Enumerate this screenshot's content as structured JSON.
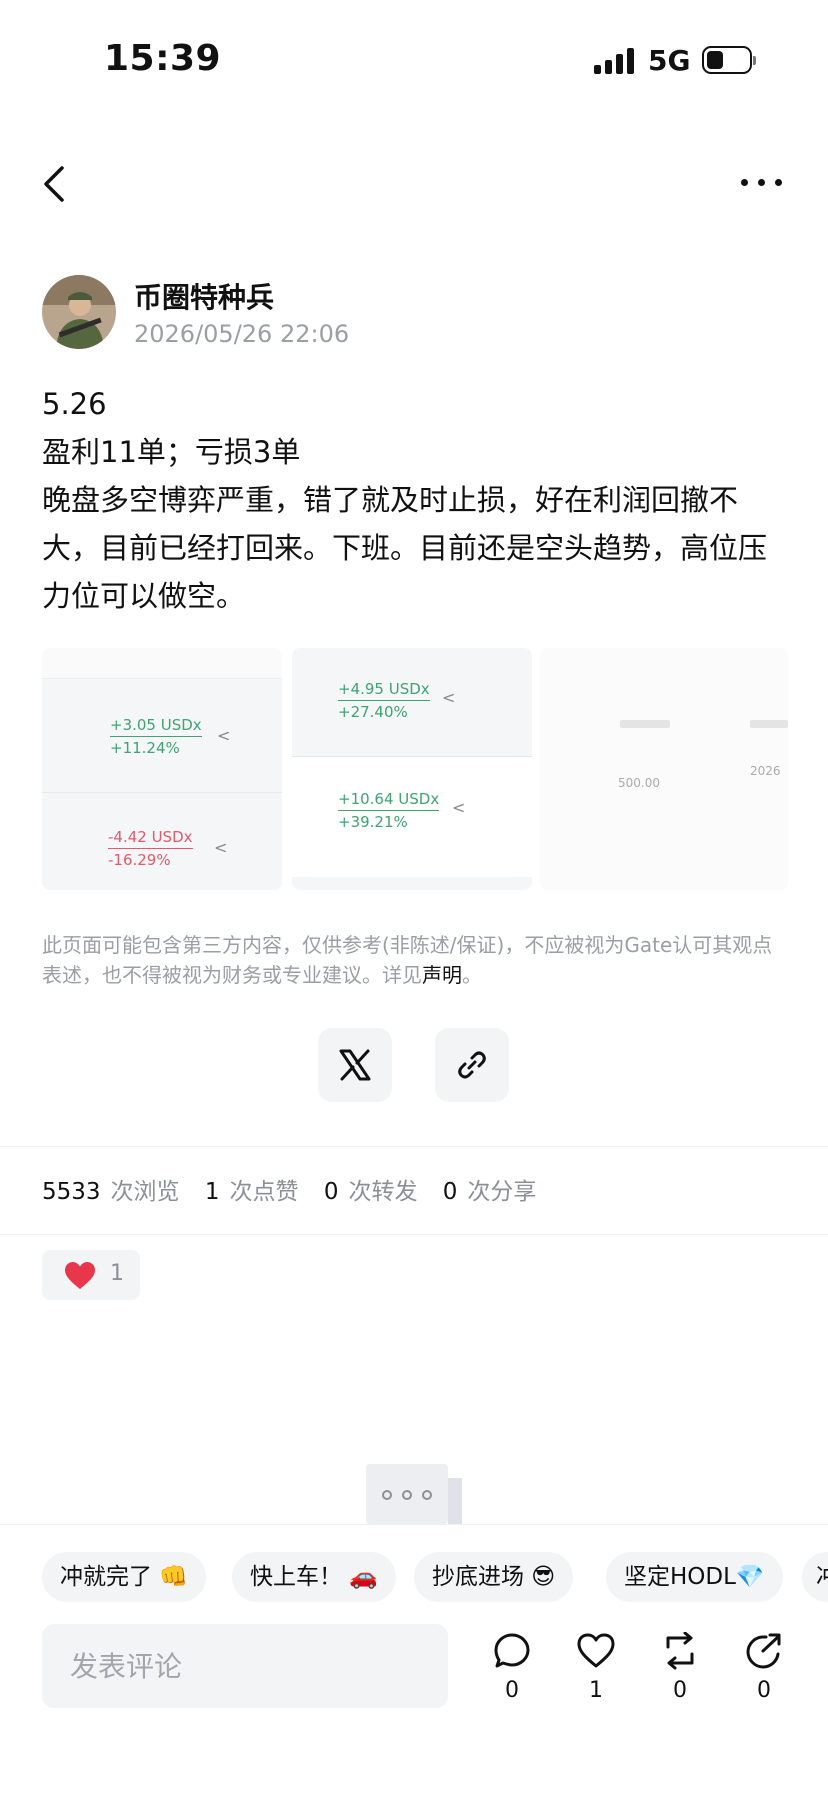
{
  "status_bar": {
    "time": "15:39",
    "network": "5G"
  },
  "author": {
    "name": "币圈特种兵",
    "date": "2026/05/26 22:06"
  },
  "post": {
    "lines": [
      "5.26",
      "盈利11单；亏损3单",
      "晚盘多空博弈严重，错了就及时止损，好在利润回撤不大，目前已经打回来。下班。目前还是空头趋势，高位压力位可以做空。"
    ],
    "images": [
      {
        "rows": [
          {
            "amount": "+3.05 USDx",
            "percent": "+11.24%",
            "color": "#3fa374"
          },
          {
            "amount": "-4.42 USDx",
            "percent": "-16.29%",
            "color": "#e15a6b"
          }
        ]
      },
      {
        "rows": [
          {
            "amount": "+4.95 USDx",
            "percent": "+27.40%",
            "color": "#3fa374"
          },
          {
            "amount": "+10.64 USDx",
            "percent": "+39.21%",
            "color": "#3fa374"
          }
        ]
      },
      {
        "value": "500.00",
        "year": "2026"
      }
    ]
  },
  "disclaimer": {
    "text": "此页面可能包含第三方内容，仅供参考(非陈述/保证)，不应被视为Gate认可其观点表述，也不得被视为财务或专业建议。详见",
    "link": "声明",
    "end": "。"
  },
  "stats": [
    {
      "value": "5533",
      "label": "次浏览"
    },
    {
      "value": "1",
      "label": "次点赞"
    },
    {
      "value": "0",
      "label": "次转发"
    },
    {
      "value": "0",
      "label": "次分享"
    }
  ],
  "reaction": {
    "count": "1"
  },
  "quick_replies": [
    "冲就完了 👊",
    "快上车！ 🚗",
    "抄底进场 😎",
    "坚定HODL💎",
    "冲"
  ],
  "composer": {
    "placeholder": "发表评论"
  },
  "actions": [
    {
      "name": "comment",
      "count": "0"
    },
    {
      "name": "like",
      "count": "1"
    },
    {
      "name": "repost",
      "count": "0"
    },
    {
      "name": "share",
      "count": "0"
    }
  ],
  "colors": {
    "accent_red": "#e8374a",
    "positive": "#3fa374",
    "negative": "#e15a6b"
  }
}
